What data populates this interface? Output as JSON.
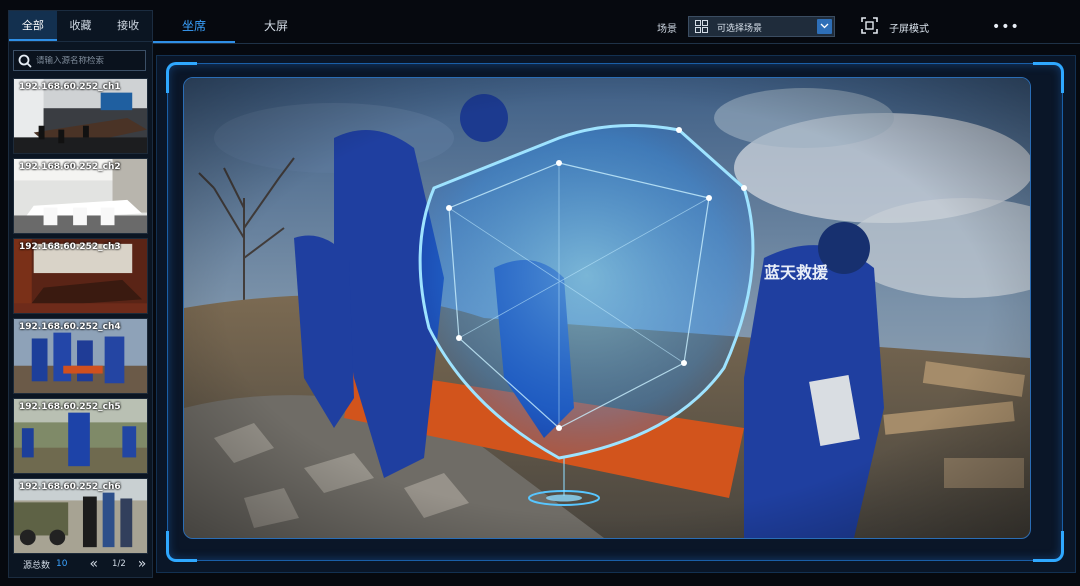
{
  "left_panel": {
    "tabs": [
      {
        "label": "全部",
        "active": true
      },
      {
        "label": "收藏",
        "active": false
      },
      {
        "label": "接收",
        "active": false
      }
    ],
    "search": {
      "placeholder": "请输入源名称检索",
      "value": ""
    },
    "sources": [
      {
        "label": "192.168.60.252_ch1",
        "scene": "meeting-room"
      },
      {
        "label": "192.168.60.252_ch2",
        "scene": "white-meeting-room"
      },
      {
        "label": "192.168.60.252_ch3",
        "scene": "wood-conference-room"
      },
      {
        "label": "192.168.60.252_ch4",
        "scene": "rescue-team"
      },
      {
        "label": "192.168.60.252_ch5",
        "scene": "outdoor-rescue"
      },
      {
        "label": "192.168.60.252_ch6",
        "scene": "vehicle-crowd"
      }
    ],
    "footer": {
      "total_label": "源总数",
      "total_count": "10",
      "prev_icon": "double-chevron-left-icon",
      "page": "1/2",
      "next_icon": "double-chevron-right-icon"
    }
  },
  "top_bar": {
    "tabs": [
      {
        "label": "坐席",
        "active": true
      },
      {
        "label": "大屏",
        "active": false
      }
    ],
    "scene_label": "场景",
    "scene_select": {
      "value": "可选择场景",
      "icon": "grid-icon"
    },
    "subscreen": {
      "label": "子屏模式",
      "icon": "focus-frame-icon"
    },
    "more_icon": "more-dots-icon",
    "more_text": "•••"
  },
  "viewer": {
    "frame_color": "#2fa8ff",
    "scene": "rescue-team-with-shield-overlay",
    "overlay_icon": "shield-icon"
  },
  "colors": {
    "accent": "#2f8fe6",
    "active_text": "#3aa2ff",
    "background": "#06090f",
    "panel": "#0b1522"
  }
}
